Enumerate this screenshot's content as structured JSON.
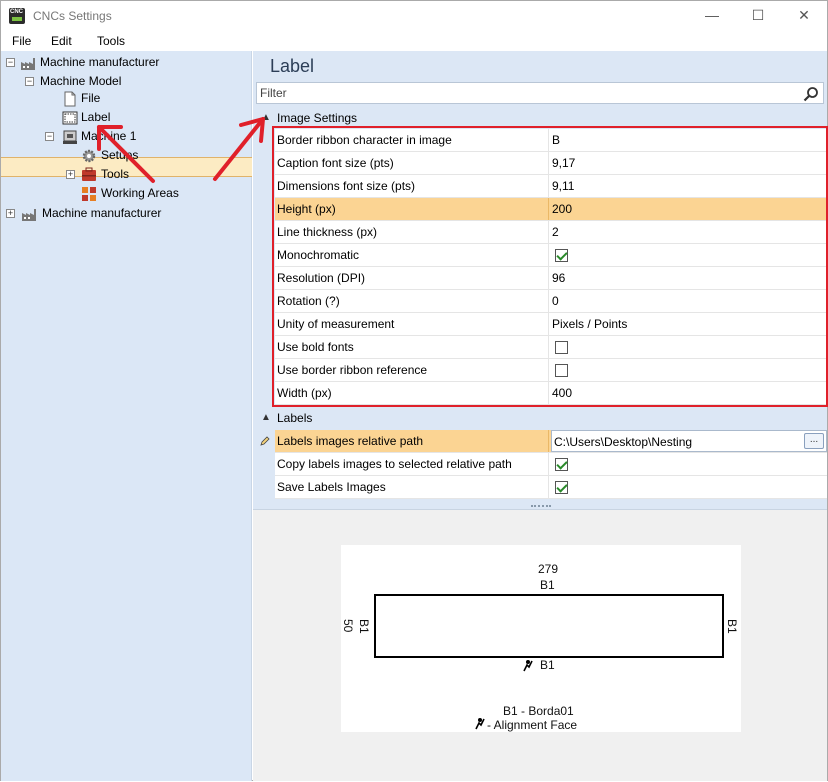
{
  "window": {
    "title": "CNCs Settings",
    "icon_text": "CNC",
    "minimize": "—",
    "maximize": "☐",
    "close": "✕"
  },
  "menu": [
    {
      "label": "File"
    },
    {
      "label": "Edit"
    },
    {
      "label": "Tools"
    }
  ],
  "tree": {
    "items": [
      {
        "label": "Machine manufacturer",
        "icon": "factory-icon"
      },
      {
        "label": "Machine Model",
        "icon": ""
      },
      {
        "label": "File",
        "icon": "file-icon"
      },
      {
        "label": "Label",
        "icon": "label-icon"
      },
      {
        "label": "Machine 1",
        "icon": "machine-icon"
      },
      {
        "label": "Setups",
        "icon": "gear-icon"
      },
      {
        "label": "Tools",
        "icon": "tools-icon"
      },
      {
        "label": "Working Areas",
        "icon": "grid-icon"
      },
      {
        "label": "Machine manufacturer",
        "icon": "factory-icon"
      }
    ]
  },
  "panel": {
    "title": "Label",
    "filter_placeholder": "Filter"
  },
  "image_settings": {
    "category": "Image Settings",
    "rows": [
      {
        "key": "Border ribbon character in image",
        "value": "B"
      },
      {
        "key": "Caption font size (pts)",
        "value": "9,17"
      },
      {
        "key": "Dimensions font size (pts)",
        "value": "9,11"
      },
      {
        "key": "Height (px)",
        "value": "200"
      },
      {
        "key": "Line thickness (px)",
        "value": "2"
      },
      {
        "key": "Monochromatic",
        "value": true
      },
      {
        "key": "Resolution (DPI)",
        "value": "96"
      },
      {
        "key": "Rotation (?)",
        "value": "0"
      },
      {
        "key": "Unity of measurement",
        "value": "Pixels / Points"
      },
      {
        "key": "Use bold fonts",
        "value": false
      },
      {
        "key": "Use border ribbon reference",
        "value": false
      },
      {
        "key": "Width (px)",
        "value": "400"
      }
    ]
  },
  "labels": {
    "category": "Labels",
    "rows": [
      {
        "key": "Labels images relative path",
        "value": "C:\\Users\\Desktop\\Nesting",
        "button": "..."
      },
      {
        "key": "Copy labels images to selected relative path",
        "value": true
      },
      {
        "key": "Save Labels Images",
        "value": true
      }
    ]
  },
  "preview": {
    "width_dim": "279",
    "top_edge": "B1",
    "height_dim": "50",
    "left_edge": "B1",
    "right_edge": "B1",
    "bottom_edge": "B1",
    "legend_line1": "B1 - Borda01",
    "legend_line2": "- Alignment Face"
  },
  "colors": {
    "selection": "#fbd493",
    "tree_bg": "#dbe7f6",
    "highlight_box": "#e0202a",
    "annotation_arrow": "#e0202a"
  }
}
